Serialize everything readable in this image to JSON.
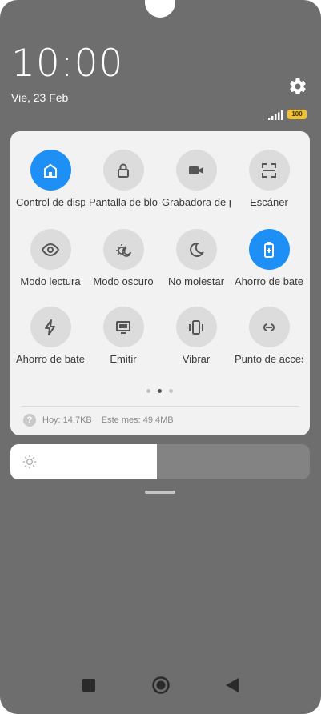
{
  "status": {
    "time": "10:00",
    "date": "Vie, 23 Feb",
    "battery": "100"
  },
  "tiles": [
    {
      "label": "Control de dispositivos",
      "icon": "home-icon",
      "active": true
    },
    {
      "label": "Pantalla de bloqueo",
      "icon": "lock-icon",
      "active": false
    },
    {
      "label": "Grabadora de pantalla",
      "icon": "video-camera-icon",
      "active": false
    },
    {
      "label": "Escáner",
      "icon": "scan-icon",
      "active": false
    },
    {
      "label": "Modo lectura",
      "icon": "eye-icon",
      "active": false
    },
    {
      "label": "Modo oscuro",
      "icon": "dark-mode-icon",
      "active": false
    },
    {
      "label": "No molestar",
      "icon": "moon-icon",
      "active": false
    },
    {
      "label": "Ahorro de batería",
      "icon": "battery-saver-icon",
      "active": true
    },
    {
      "label": "Ahorro de batería",
      "icon": "lightning-icon",
      "active": false
    },
    {
      "label": "Emitir",
      "icon": "cast-icon",
      "active": false
    },
    {
      "label": "Vibrar",
      "icon": "vibrate-icon",
      "active": false
    },
    {
      "label": "Punto de acceso",
      "icon": "hotspot-icon",
      "active": false
    }
  ],
  "pager": {
    "pages": 3,
    "current": 2
  },
  "data_usage": {
    "today": "Hoy: 14,7KB",
    "month": "Este mes: 49,4MB"
  },
  "brightness": {
    "level": 0.49
  },
  "colors": {
    "accent": "#1e90f5",
    "background": "#6e6e6e",
    "panel": "#f2f2f2"
  }
}
